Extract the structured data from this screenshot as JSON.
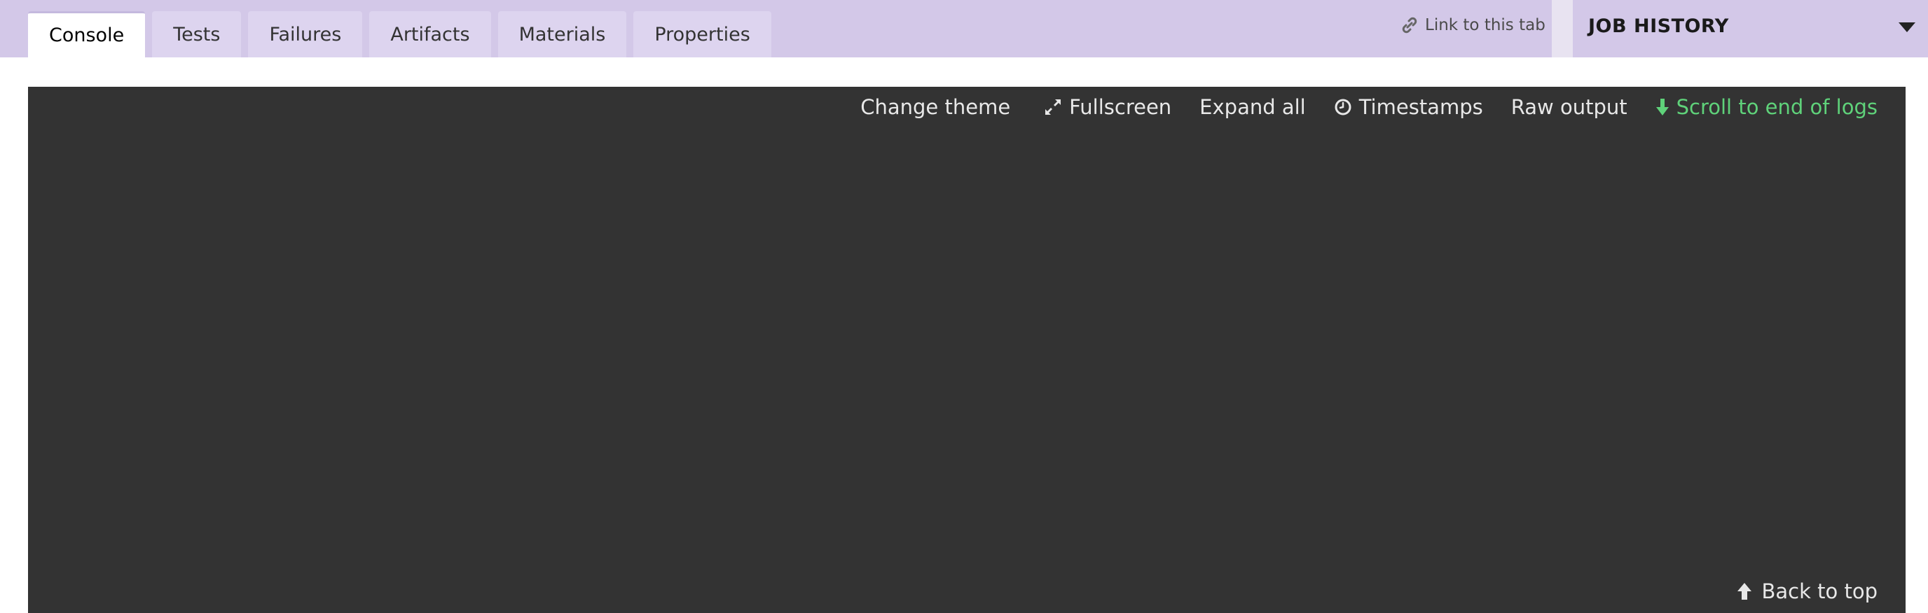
{
  "tabs": [
    {
      "label": "Console",
      "active": true
    },
    {
      "label": "Tests",
      "active": false
    },
    {
      "label": "Failures",
      "active": false
    },
    {
      "label": "Artifacts",
      "active": false
    },
    {
      "label": "Materials",
      "active": false
    },
    {
      "label": "Properties",
      "active": false
    }
  ],
  "link_tab": {
    "label": "Link to this tab",
    "icon": "link-icon"
  },
  "job_history": {
    "label": "JOB HISTORY",
    "icon": "caret-down-icon"
  },
  "console": {
    "toolbar": {
      "change_theme": "Change theme",
      "fullscreen": "Fullscreen",
      "expand_all": "Expand all",
      "timestamps": "Timestamps",
      "raw_output": "Raw output",
      "scroll_to_end": "Scroll to end of logs"
    },
    "back_to_top": "Back to top"
  },
  "colors": {
    "topbar_bg": "#d3c8e8",
    "console_bg": "#333333",
    "accent_green": "#5fd27a"
  }
}
